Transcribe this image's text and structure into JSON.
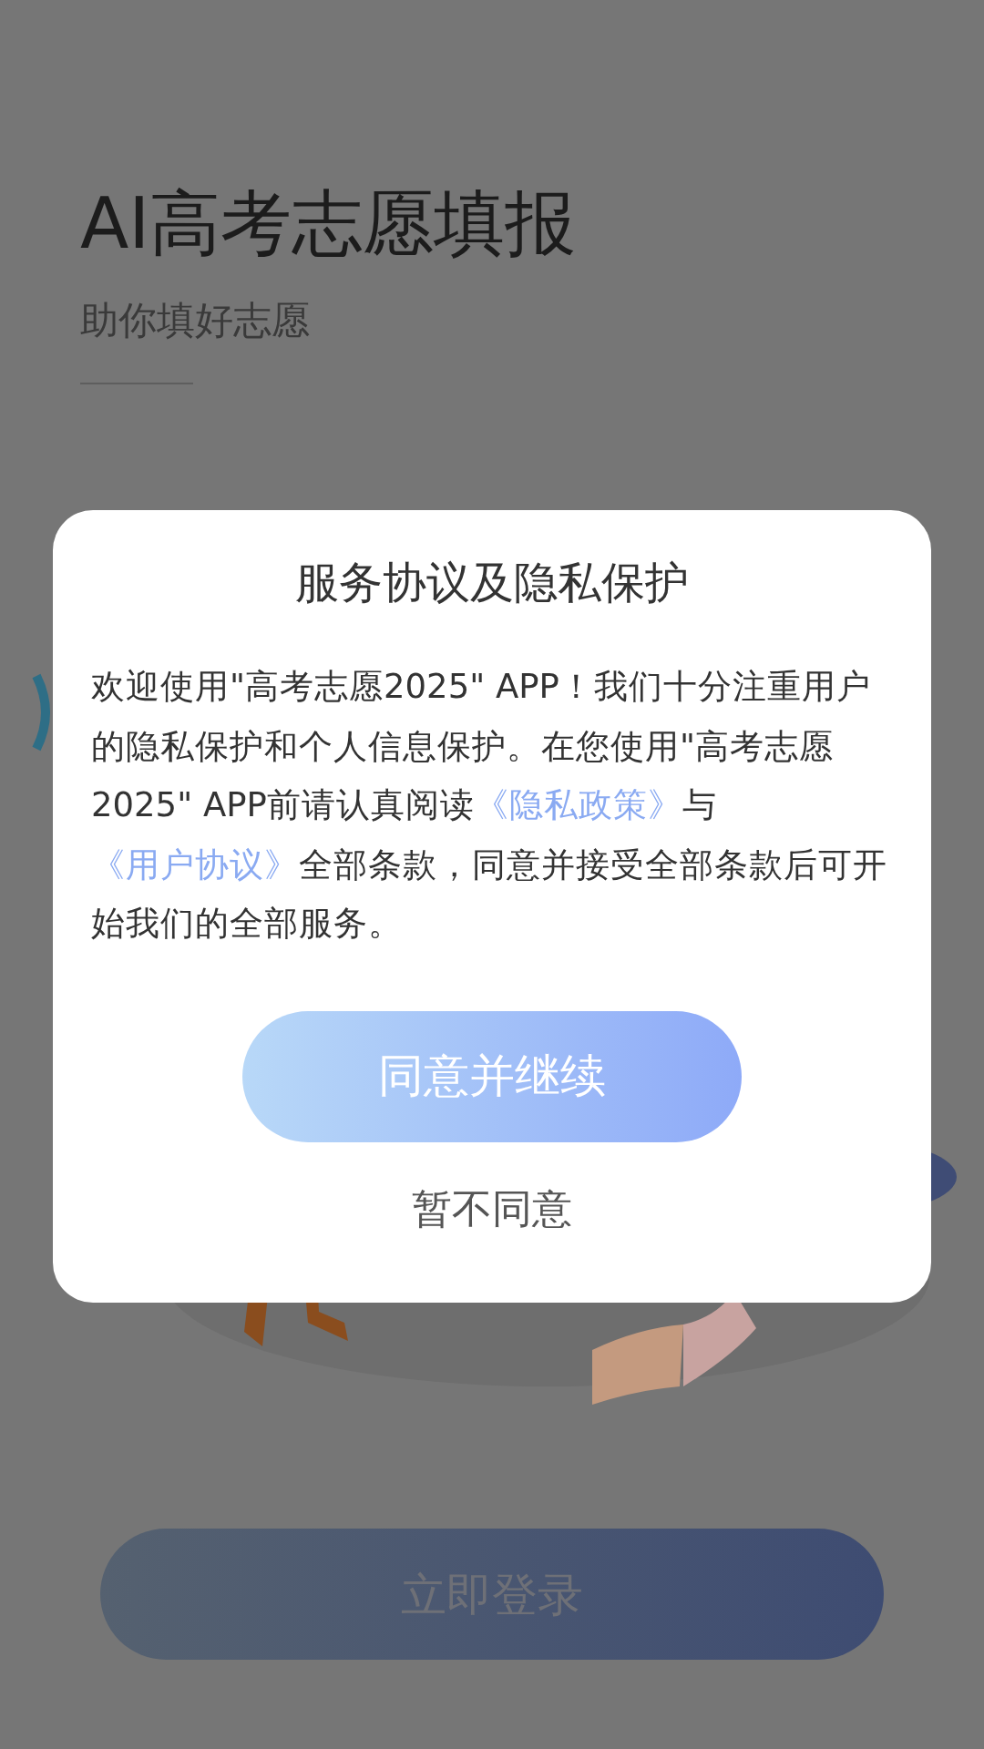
{
  "header": {
    "title": "AI高考志愿填报",
    "subtitle": "助你填好志愿"
  },
  "dialog": {
    "title": "服务协议及隐私保护",
    "body": [
      {
        "kind": "text",
        "text": "欢迎使用\"高考志愿2025\" APP！我们十分注重用户的隐私保护和个人信息保护。在您使用\"高考志愿2025\" APP前请认真阅读"
      },
      {
        "kind": "link",
        "text": "《隐私政策》"
      },
      {
        "kind": "text",
        "text": "与"
      },
      {
        "kind": "link",
        "text": "《用户协议》"
      },
      {
        "kind": "text",
        "text": "全部条款，同意并接受全部条款后可开始我们的全部服务。"
      }
    ],
    "agree_button": "同意并继续",
    "decline_button": "暂不同意"
  },
  "login_button": "立即登录"
}
